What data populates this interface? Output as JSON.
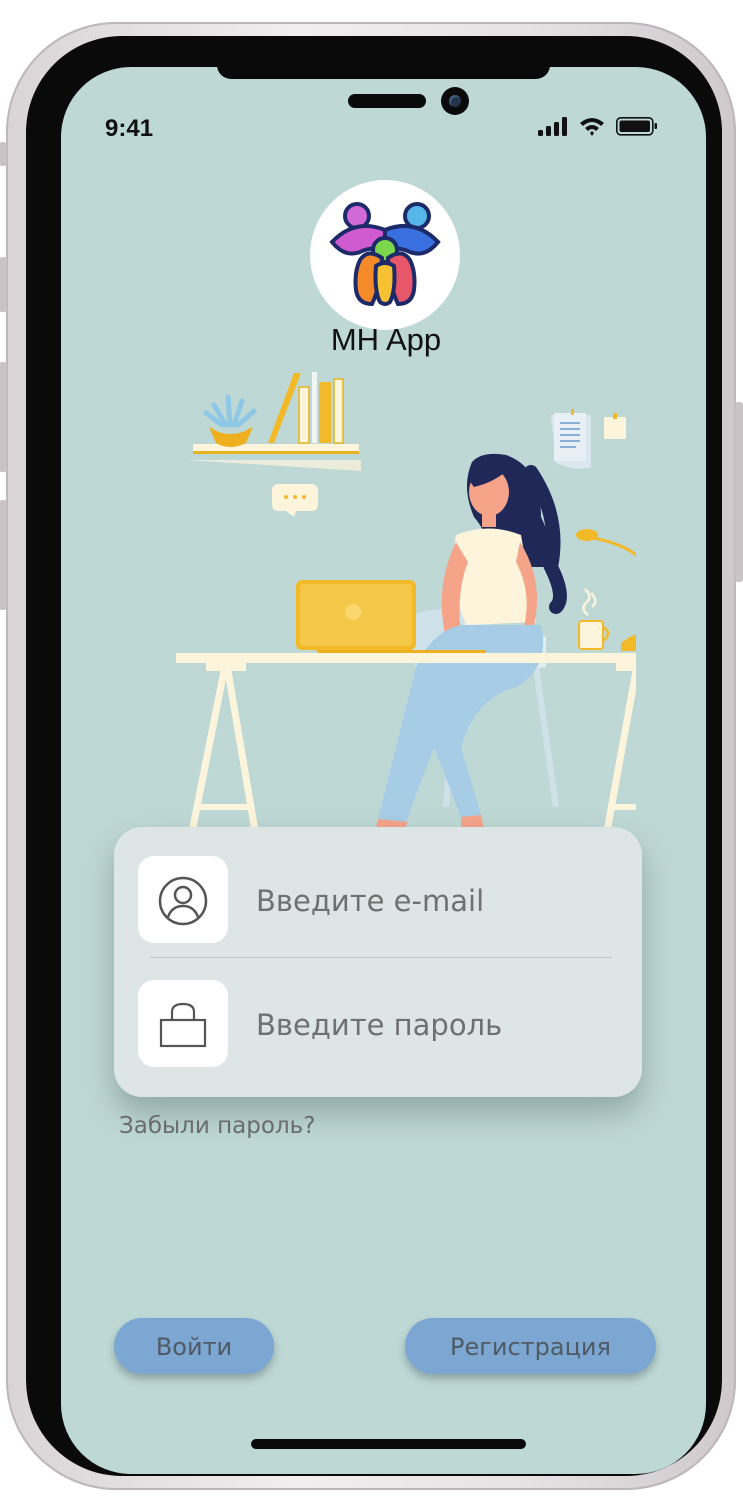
{
  "status_bar": {
    "time": "9:41",
    "icons": [
      "cellular-signal-icon",
      "wifi-icon",
      "battery-icon"
    ]
  },
  "app": {
    "name": "MH App",
    "logo_icon": "family-logo-icon"
  },
  "illustration": {
    "icon": "woman-working-at-laptop-illustration"
  },
  "login_form": {
    "email": {
      "placeholder": "Введите e-mail",
      "value": "",
      "icon": "user-icon"
    },
    "password": {
      "placeholder": "Введите пароль",
      "value": "",
      "icon": "lock-icon"
    }
  },
  "forgot_password_link": "Забыли пароль?",
  "buttons": {
    "login_label": "Войти",
    "register_label": "Регистрация"
  },
  "colors": {
    "background": "#bed8d5",
    "card": "#dde6e5",
    "button": "#7ba7d2",
    "accent_yellow": "#f2b928"
  }
}
